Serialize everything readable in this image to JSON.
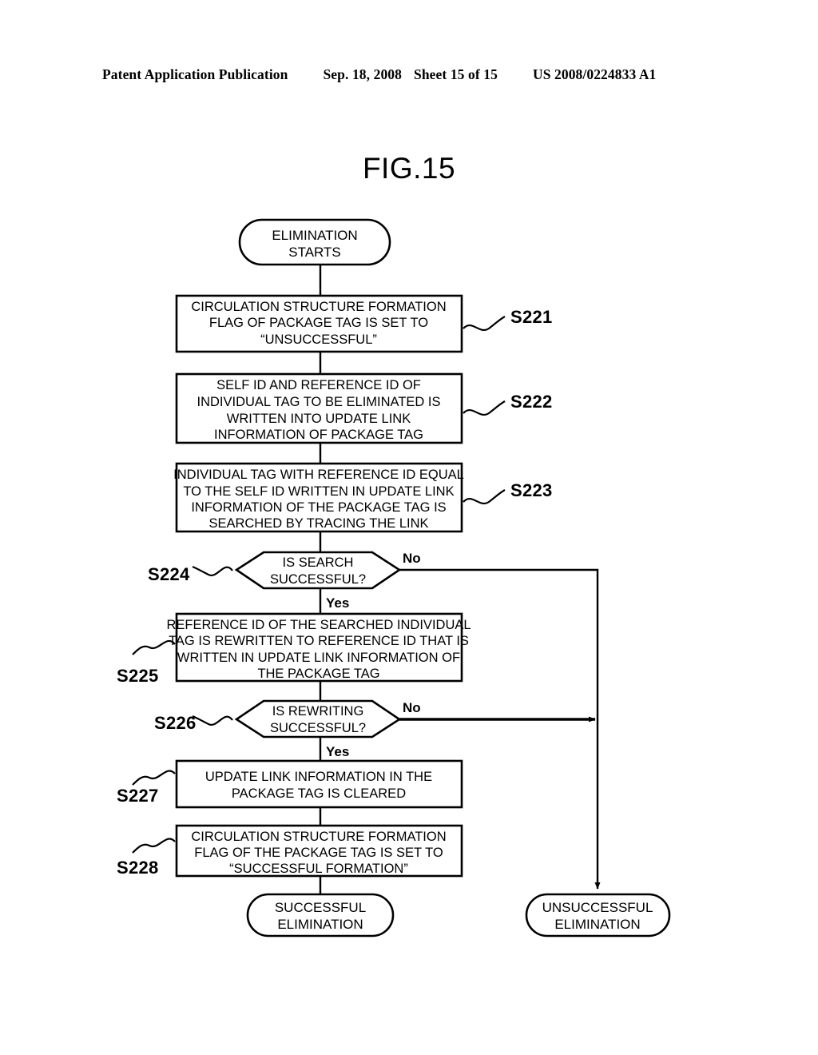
{
  "header": {
    "publication": "Patent Application Publication",
    "date": "Sep. 18, 2008",
    "sheet": "Sheet 15 of 15",
    "number": "US 2008/0224833 A1"
  },
  "figure": {
    "title": "FIG.15"
  },
  "chart_data": {
    "type": "diagram",
    "diagram_kind": "flowchart",
    "title": "FIG.15",
    "nodes": [
      {
        "id": "start",
        "shape": "terminator",
        "lines": [
          "ELIMINATION",
          "STARTS"
        ],
        "step": ""
      },
      {
        "id": "s221",
        "shape": "process",
        "lines": [
          "CIRCULATION STRUCTURE FORMATION",
          "FLAG OF PACKAGE TAG IS SET TO",
          "“UNSUCCESSFUL”"
        ],
        "step": "S221"
      },
      {
        "id": "s222",
        "shape": "process",
        "lines": [
          "SELF ID AND REFERENCE ID OF",
          "INDIVIDUAL TAG TO BE ELIMINATED IS",
          "WRITTEN INTO UPDATE LINK",
          "INFORMATION OF PACKAGE TAG"
        ],
        "step": "S222"
      },
      {
        "id": "s223",
        "shape": "process",
        "lines": [
          "INDIVIDUAL TAG WITH REFERENCE ID EQUAL",
          "TO THE SELF ID WRITTEN IN UPDATE LINK",
          "INFORMATION OF THE PACKAGE TAG IS",
          "SEARCHED BY TRACING THE LINK"
        ],
        "step": "S223"
      },
      {
        "id": "s224",
        "shape": "decision",
        "lines": [
          "IS SEARCH",
          "SUCCESSFUL?"
        ],
        "step": "S224"
      },
      {
        "id": "s225",
        "shape": "process",
        "lines": [
          "REFERENCE ID OF THE SEARCHED INDIVIDUAL",
          "TAG IS REWRITTEN TO REFERENCE ID THAT IS",
          "WRITTEN IN UPDATE LINK INFORMATION OF",
          "THE PACKAGE TAG"
        ],
        "step": "S225"
      },
      {
        "id": "s226",
        "shape": "decision",
        "lines": [
          "IS REWRITING",
          "SUCCESSFUL?"
        ],
        "step": "S226"
      },
      {
        "id": "s227",
        "shape": "process",
        "lines": [
          "UPDATE LINK INFORMATION IN THE",
          "PACKAGE TAG IS CLEARED"
        ],
        "step": "S227"
      },
      {
        "id": "s228",
        "shape": "process",
        "lines": [
          "CIRCULATION STRUCTURE FORMATION",
          "FLAG OF THE PACKAGE TAG IS SET TO",
          "“SUCCESSFUL FORMATION”"
        ],
        "step": "S228"
      },
      {
        "id": "end_success",
        "shape": "terminator",
        "lines": [
          "SUCCESSFUL",
          "ELIMINATION"
        ],
        "step": ""
      },
      {
        "id": "end_fail",
        "shape": "terminator",
        "lines": [
          "UNSUCCESSFUL",
          "ELIMINATION"
        ],
        "step": ""
      }
    ],
    "edges": [
      {
        "from": "start",
        "to": "s221",
        "label": ""
      },
      {
        "from": "s221",
        "to": "s222",
        "label": ""
      },
      {
        "from": "s222",
        "to": "s223",
        "label": ""
      },
      {
        "from": "s223",
        "to": "s224",
        "label": ""
      },
      {
        "from": "s224",
        "to": "s225",
        "label": "Yes"
      },
      {
        "from": "s224",
        "to": "end_fail",
        "label": "No"
      },
      {
        "from": "s225",
        "to": "s226",
        "label": ""
      },
      {
        "from": "s226",
        "to": "s227",
        "label": "Yes"
      },
      {
        "from": "s226",
        "to": "end_fail",
        "label": "No"
      },
      {
        "from": "s227",
        "to": "s228",
        "label": ""
      },
      {
        "from": "s228",
        "to": "end_success",
        "label": ""
      }
    ],
    "branch_labels": {
      "s224_yes": "Yes",
      "s224_no": "No",
      "s226_yes": "Yes",
      "s226_no": "No"
    }
  }
}
